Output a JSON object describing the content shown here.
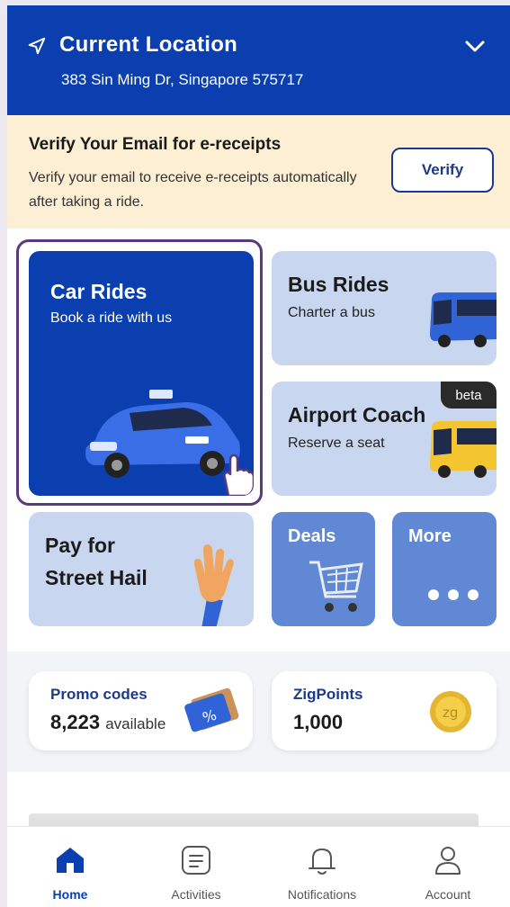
{
  "header": {
    "title": "Current Location",
    "address": "383 Sin Ming Dr, Singapore 575717",
    "icon_location": "navigation-arrow-icon",
    "icon_expand": "chevron-down-icon"
  },
  "verify_banner": {
    "title": "Verify Your Email for e-receipts",
    "description": "Verify your email to receive e-receipts automatically after taking a ride.",
    "button": "Verify"
  },
  "tiles": {
    "car": {
      "title": "Car Rides",
      "subtitle": "Book a ride with us"
    },
    "bus": {
      "title": "Bus Rides",
      "subtitle": "Charter a bus"
    },
    "coach": {
      "title": "Airport Coach",
      "subtitle": "Reserve a seat",
      "badge": "beta"
    },
    "pay": {
      "line1": "Pay for",
      "line2": "Street Hail"
    },
    "deals": {
      "title": "Deals"
    },
    "more": {
      "title": "More"
    }
  },
  "cards": {
    "promo": {
      "label": "Promo codes",
      "value": "8,223",
      "suffix": "available"
    },
    "zig": {
      "label": "ZigPoints",
      "value": "1,000"
    }
  },
  "bottom_nav": [
    {
      "label": "Home",
      "icon": "home-icon",
      "active": true
    },
    {
      "label": "Activities",
      "icon": "activities-icon",
      "active": false
    },
    {
      "label": "Notifications",
      "icon": "bell-icon",
      "active": false
    },
    {
      "label": "Account",
      "icon": "user-icon",
      "active": false
    }
  ],
  "colors": {
    "primary": "#0b3fb0",
    "banner": "#fcefd4",
    "tile": "#c9d6f0",
    "tile_accent": "#6088d4"
  }
}
